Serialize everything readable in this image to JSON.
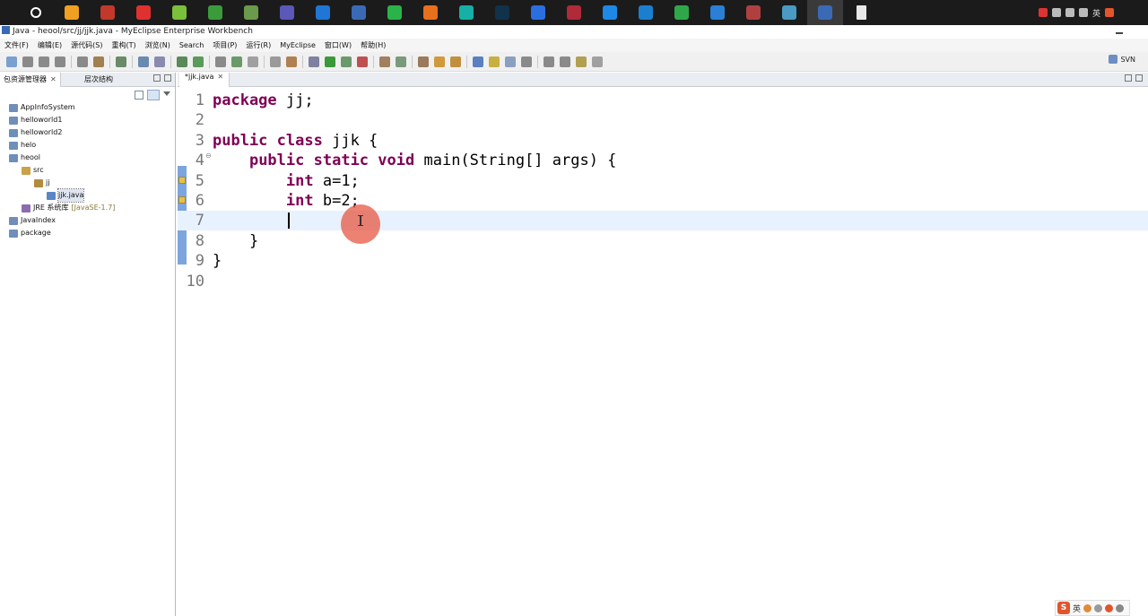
{
  "taskbar": {
    "icons": [
      {
        "name": "start-icon",
        "color": "#1b1b1b",
        "glyph": ""
      },
      {
        "name": "cortana-icon",
        "color": "#1b1b1b",
        "glyph": "O"
      },
      {
        "name": "overwatch-icon",
        "color": "#f0a020",
        "glyph": "^"
      },
      {
        "name": "qq-penguin-icon",
        "color": "#c0392b",
        "glyph": "Q"
      },
      {
        "name": "netease-music-icon",
        "color": "#e03030",
        "glyph": "◎"
      },
      {
        "name": "qq-browser-icon",
        "color": "#7bbf3a",
        "glyph": "◐"
      },
      {
        "name": "chrome-icon",
        "color": "#3b9b3b",
        "glyph": "◉"
      },
      {
        "name": "notepad-icon",
        "color": "#6a9a4a",
        "glyph": "▤"
      },
      {
        "name": "eclipse-icon",
        "color": "#5b58b8",
        "glyph": "☾"
      },
      {
        "name": "edge-icon",
        "color": "#1f76d4",
        "glyph": "e"
      },
      {
        "name": "myeclipse-icon",
        "color": "#3a6ab5",
        "glyph": "ℳ"
      },
      {
        "name": "wechat-icon",
        "color": "#2bb34a",
        "glyph": "✉"
      },
      {
        "name": "firefox-icon",
        "color": "#e8701c",
        "glyph": "◔"
      },
      {
        "name": "webstorm-icon",
        "color": "#16b0a5",
        "glyph": "WS"
      },
      {
        "name": "photoshop-icon",
        "color": "#10324a",
        "glyph": "Ps"
      },
      {
        "name": "sogou-icon",
        "color": "#2b6ee0",
        "glyph": "S"
      },
      {
        "name": "flash-icon",
        "color": "#b02a3a",
        "glyph": "f"
      },
      {
        "name": "react-icon",
        "color": "#1e88e5",
        "glyph": "⚛"
      },
      {
        "name": "vscode-icon",
        "color": "#1b7fd0",
        "glyph": "◤"
      },
      {
        "name": "hbuilder-icon",
        "color": "#2fa84a",
        "glyph": "H"
      },
      {
        "name": "cloud-app-icon",
        "color": "#2b7fd4",
        "glyph": "☁"
      },
      {
        "name": "image-viewer-icon",
        "color": "#b04040",
        "glyph": "▦"
      },
      {
        "name": "book-app-icon",
        "color": "#4a9ac4",
        "glyph": "▭"
      },
      {
        "name": "myeclipse-active-icon",
        "color": "#3a6ab5",
        "glyph": "ℳ"
      },
      {
        "name": "document-icon",
        "color": "#e8e8e8",
        "glyph": ""
      }
    ],
    "tray_lang": "英"
  },
  "window": {
    "title": "Java  -  heool/src/jj/jjk.java  -  MyEclipse Enterprise Workbench"
  },
  "menu": [
    "文件(F)",
    "编辑(E)",
    "源代码(S)",
    "重构(T)",
    "浏览(N)",
    "Search",
    "项目(P)",
    "运行(R)",
    "MyEclipse",
    "窗口(W)",
    "帮助(H)"
  ],
  "perspective": {
    "label": "SVN"
  },
  "explorer": {
    "tabs": [
      "包资源管理器",
      "层次结构"
    ],
    "tree": [
      {
        "label": "AppInfoSystem",
        "icon": "proj",
        "indent": 0
      },
      {
        "label": "helloworld1",
        "icon": "proj",
        "indent": 0
      },
      {
        "label": "helloworld2",
        "icon": "proj",
        "indent": 0
      },
      {
        "label": "helo",
        "icon": "proj",
        "indent": 0
      },
      {
        "label": "heool",
        "icon": "proj",
        "indent": 0
      },
      {
        "label": "src",
        "icon": "src",
        "indent": 1
      },
      {
        "label": "jj",
        "icon": "pkg",
        "indent": 2
      },
      {
        "label": "jjk.java",
        "icon": "java",
        "indent": 3,
        "selected": true
      },
      {
        "label": "JRE 系统库",
        "suffix": "[JavaSE-1.7]",
        "icon": "jre",
        "indent": 1
      },
      {
        "label": "JavaIndex",
        "icon": "proj",
        "indent": 0
      },
      {
        "label": "package",
        "icon": "proj",
        "indent": 0
      }
    ]
  },
  "editor": {
    "tab_label": "*jjk.java",
    "lines": [
      {
        "num": "1",
        "code": "<span class=\"kw\">package</span> jj;"
      },
      {
        "num": "2",
        "code": ""
      },
      {
        "num": "3",
        "code": "<span class=\"kw\">public</span> <span class=\"kw\">class</span> jjk {"
      },
      {
        "num": "4",
        "code": "    <span class=\"kw\">public</span> <span class=\"kw\">static</span> <span class=\"kw\">void</span> main(String[] args) {",
        "fold": true
      },
      {
        "num": "5",
        "code": "        <span class=\"kw\">int</span> a=1;",
        "marker": true
      },
      {
        "num": "6",
        "code": "        <span class=\"kw\">int</span> b=2;",
        "marker": true
      },
      {
        "num": "7",
        "code": "        ",
        "current": true
      },
      {
        "num": "8",
        "code": "    }"
      },
      {
        "num": "9",
        "code": "}"
      },
      {
        "num": "10",
        "code": ""
      }
    ]
  },
  "ime": {
    "label": "英"
  }
}
